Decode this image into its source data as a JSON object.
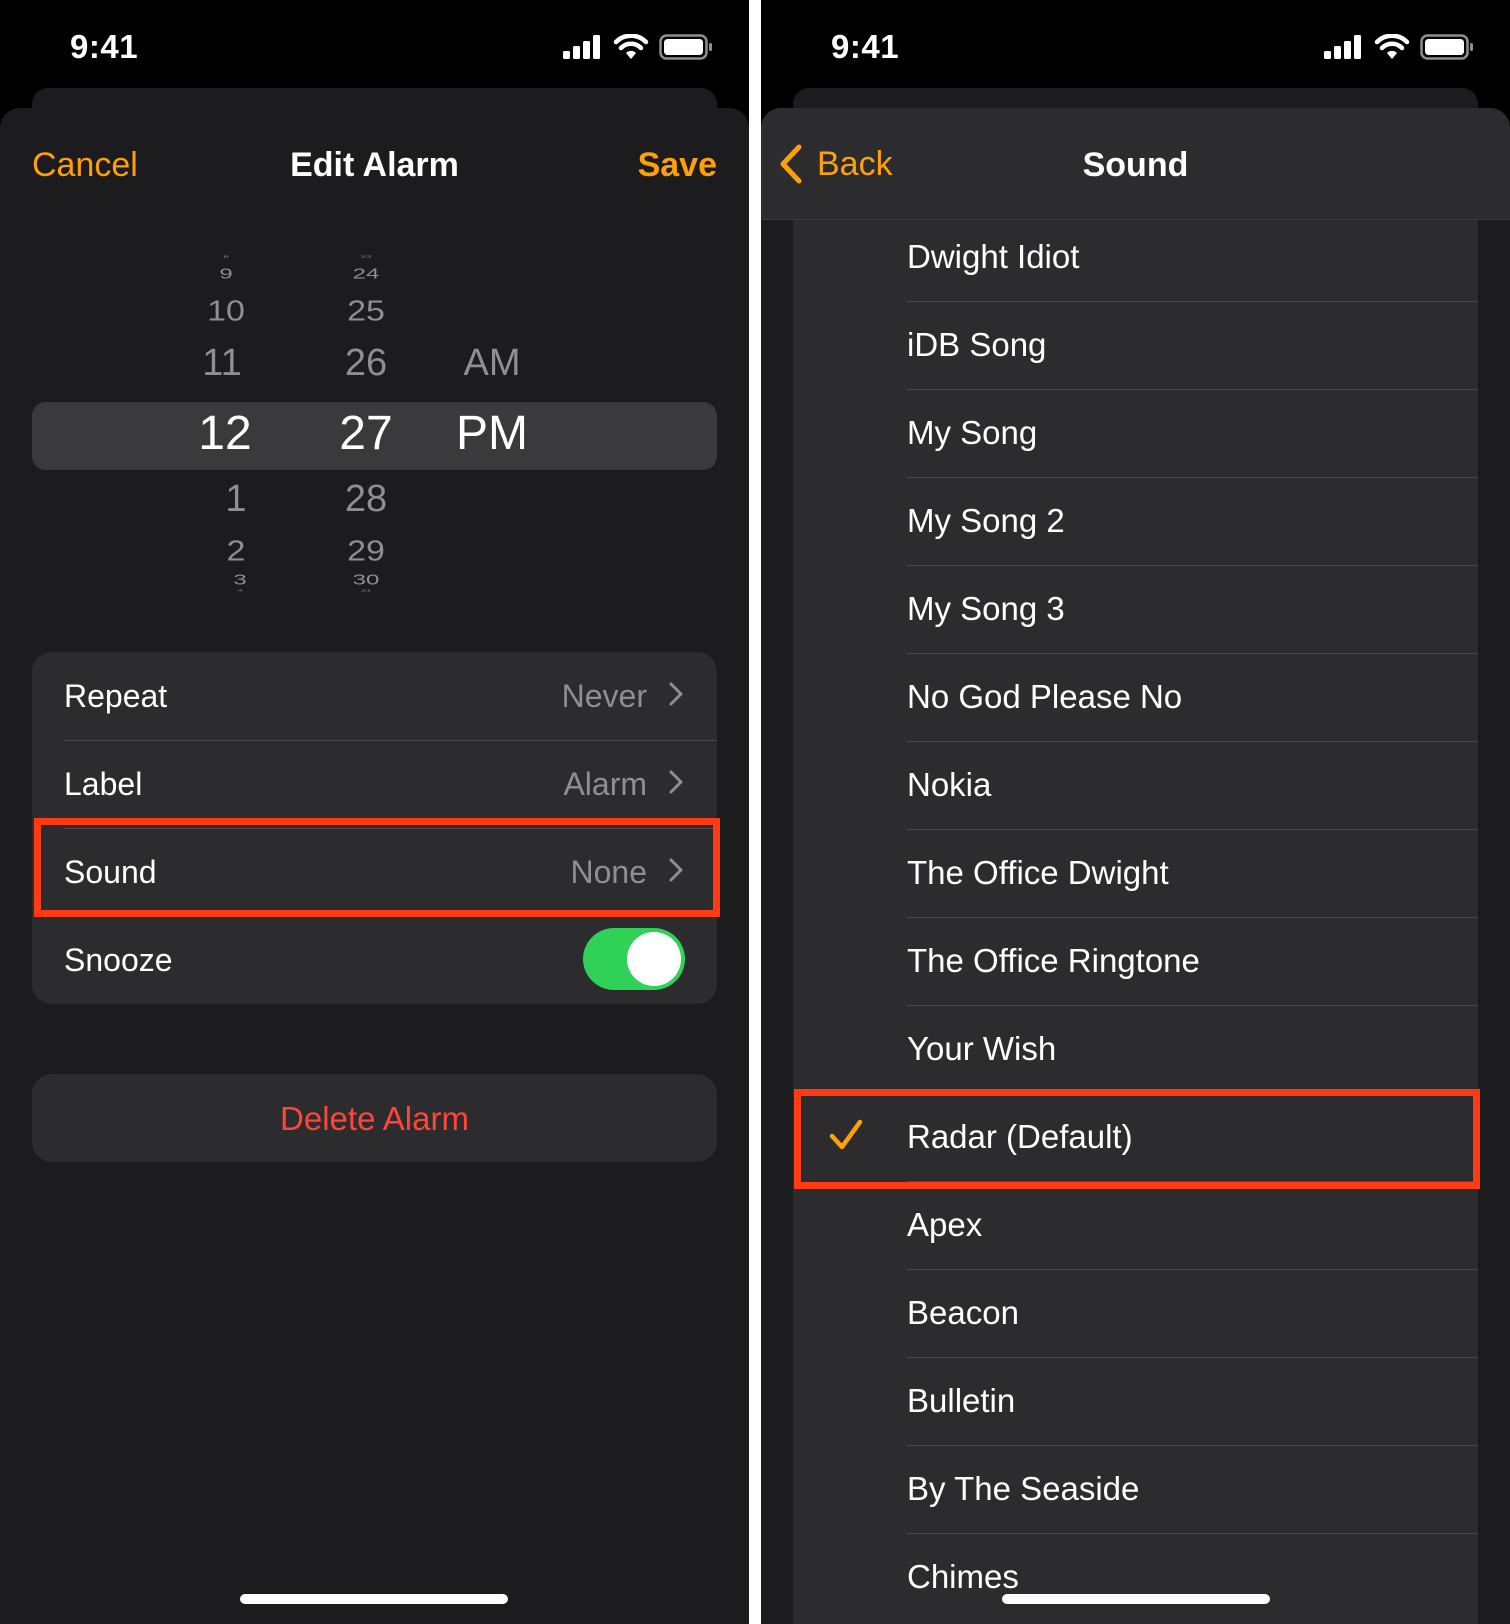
{
  "left": {
    "status": {
      "time": "9:41"
    },
    "nav": {
      "cancel": "Cancel",
      "title": "Edit Alarm",
      "save": "Save"
    },
    "picker": {
      "hours": [
        "8",
        "9",
        "10",
        "11",
        "12",
        "1",
        "2",
        "3",
        "4"
      ],
      "minutes": [
        "23",
        "24",
        "25",
        "26",
        "27",
        "28",
        "29",
        "30",
        "31"
      ],
      "periods": [
        "AM",
        "PM"
      ],
      "selected": {
        "hour": "12",
        "minute": "27",
        "period": "PM"
      }
    },
    "settings": {
      "repeat": {
        "label": "Repeat",
        "value": "Never"
      },
      "label": {
        "label": "Label",
        "value": "Alarm"
      },
      "sound": {
        "label": "Sound",
        "value": "None"
      },
      "snooze": {
        "label": "Snooze",
        "on": true
      }
    },
    "delete_label": "Delete Alarm"
  },
  "right": {
    "status": {
      "time": "9:41"
    },
    "nav": {
      "back": "Back",
      "title": "Sound"
    },
    "sounds": [
      "Dwight Idiot",
      "iDB Song",
      "My Song",
      "My Song 2",
      "My Song 3",
      "No God Please No",
      "Nokia",
      "The Office Dwight",
      "The Office Ringtone",
      "Your Wish",
      "Radar (Default)",
      "Apex",
      "Beacon",
      "Bulletin",
      "By The Seaside",
      "Chimes"
    ],
    "selected_sound": "Radar (Default)"
  },
  "colors": {
    "accent": "#ff9f0a",
    "destructive": "#ff453a",
    "toggle_on": "#30d158",
    "highlight": "#ff3b14",
    "background": "#1c1c1e",
    "cell": "#2c2c2e"
  },
  "icons": [
    "signal-icon",
    "wifi-icon",
    "battery-icon",
    "chevron-right-icon",
    "chevron-left-icon",
    "checkmark-icon"
  ]
}
